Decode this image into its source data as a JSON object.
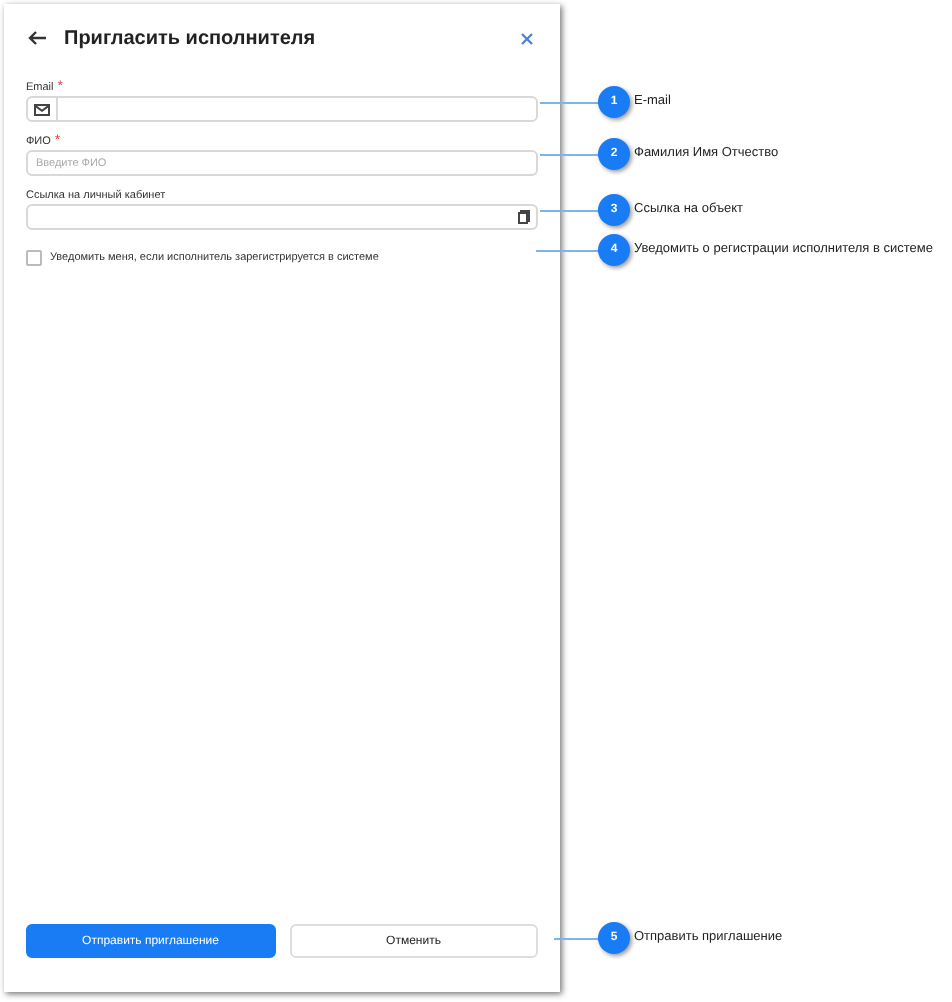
{
  "dialog": {
    "title": "Пригласить исполнителя",
    "fields": [
      {
        "kind": "email",
        "label": "Email",
        "required_mark": "*"
      },
      {
        "kind": "text",
        "label": "ФИО",
        "required_mark": "*",
        "placeholder": "Введите ФИО"
      },
      {
        "kind": "link",
        "label": "Ссылка на личный кабинет"
      }
    ],
    "checkbox": {
      "label": "Уведомить меня, если исполнитель зарегистрируется в системе",
      "checked": false
    },
    "buttons": [
      {
        "label": "Отправить приглашение",
        "primary": true
      },
      {
        "label": "Отменить",
        "primary": false
      }
    ]
  },
  "callouts": [
    {
      "number": "1",
      "text": "E-mail"
    },
    {
      "number": "2",
      "text": "Фамилия Имя Отчество"
    },
    {
      "number": "3",
      "text": "Ссылка на объект"
    },
    {
      "number": "4",
      "text": "Уведомить о регистрации исполнителя в системе"
    },
    {
      "number": "5",
      "text": "Отправить приглашение"
    }
  ]
}
